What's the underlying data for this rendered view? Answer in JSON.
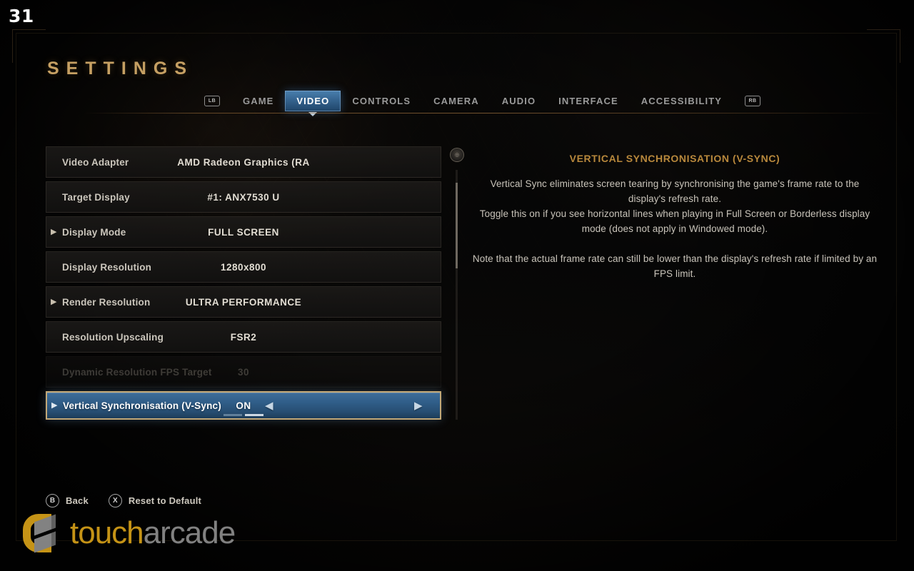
{
  "overlay": {
    "fps_counter": "31"
  },
  "header": {
    "title": "SETTINGS",
    "left_bumper": "LB",
    "right_bumper": "RB",
    "tabs": [
      {
        "label": "GAME",
        "selected": false
      },
      {
        "label": "VIDEO",
        "selected": true
      },
      {
        "label": "CONTROLS",
        "selected": false
      },
      {
        "label": "CAMERA",
        "selected": false
      },
      {
        "label": "AUDIO",
        "selected": false
      },
      {
        "label": "INTERFACE",
        "selected": false
      },
      {
        "label": "ACCESSIBILITY",
        "selected": false
      }
    ]
  },
  "settings": {
    "rows": [
      {
        "label": "Video Adapter",
        "value": "AMD Radeon Graphics (RA",
        "expandable": false,
        "disabled": false,
        "selected": false
      },
      {
        "label": "Target Display",
        "value": "#1: ANX7530 U",
        "expandable": false,
        "disabled": false,
        "selected": false
      },
      {
        "label": "Display Mode",
        "value": "FULL SCREEN",
        "expandable": true,
        "disabled": false,
        "selected": false
      },
      {
        "label": "Display Resolution",
        "value": "1280x800",
        "expandable": false,
        "disabled": false,
        "selected": false
      },
      {
        "label": "Render Resolution",
        "value": "ULTRA PERFORMANCE",
        "expandable": true,
        "disabled": false,
        "selected": false
      },
      {
        "label": "Resolution Upscaling",
        "value": "FSR2",
        "expandable": false,
        "disabled": false,
        "selected": false
      },
      {
        "label": "Dynamic Resolution FPS Target",
        "value": "30",
        "expandable": false,
        "disabled": true,
        "selected": false
      },
      {
        "label": "Vertical Synchronisation (V-Sync)",
        "value": "ON",
        "expandable": true,
        "disabled": false,
        "selected": true
      }
    ],
    "caret_glyph": "▶",
    "prev_arrow": "◀",
    "next_arrow": "▶",
    "stick_icon": "◎"
  },
  "description": {
    "title": "VERTICAL SYNCHRONISATION (V-SYNC)",
    "paragraph_1": "Vertical Sync eliminates screen tearing by synchronising the game's frame rate to the display's refresh rate.",
    "paragraph_2": "Toggle this on if you see horizontal lines when playing in Full Screen or Borderless display mode (does not apply in Windowed mode).",
    "paragraph_3": "Note that the actual frame rate can still be lower than the display's refresh rate if limited by an FPS limit."
  },
  "footer": {
    "hints": [
      {
        "button": "B",
        "label": "Back"
      },
      {
        "button": "X",
        "label": "Reset to Default"
      }
    ]
  },
  "watermark": {
    "part_1": "touch",
    "part_2": "arcade"
  },
  "colors": {
    "accent_gold": "#b8883c",
    "title_gold": "#c6a063",
    "selection_blue": "#34628d",
    "selection_border": "#c2a877",
    "text_primary": "#cbc6bc",
    "watermark_gold": "#d6a018"
  }
}
